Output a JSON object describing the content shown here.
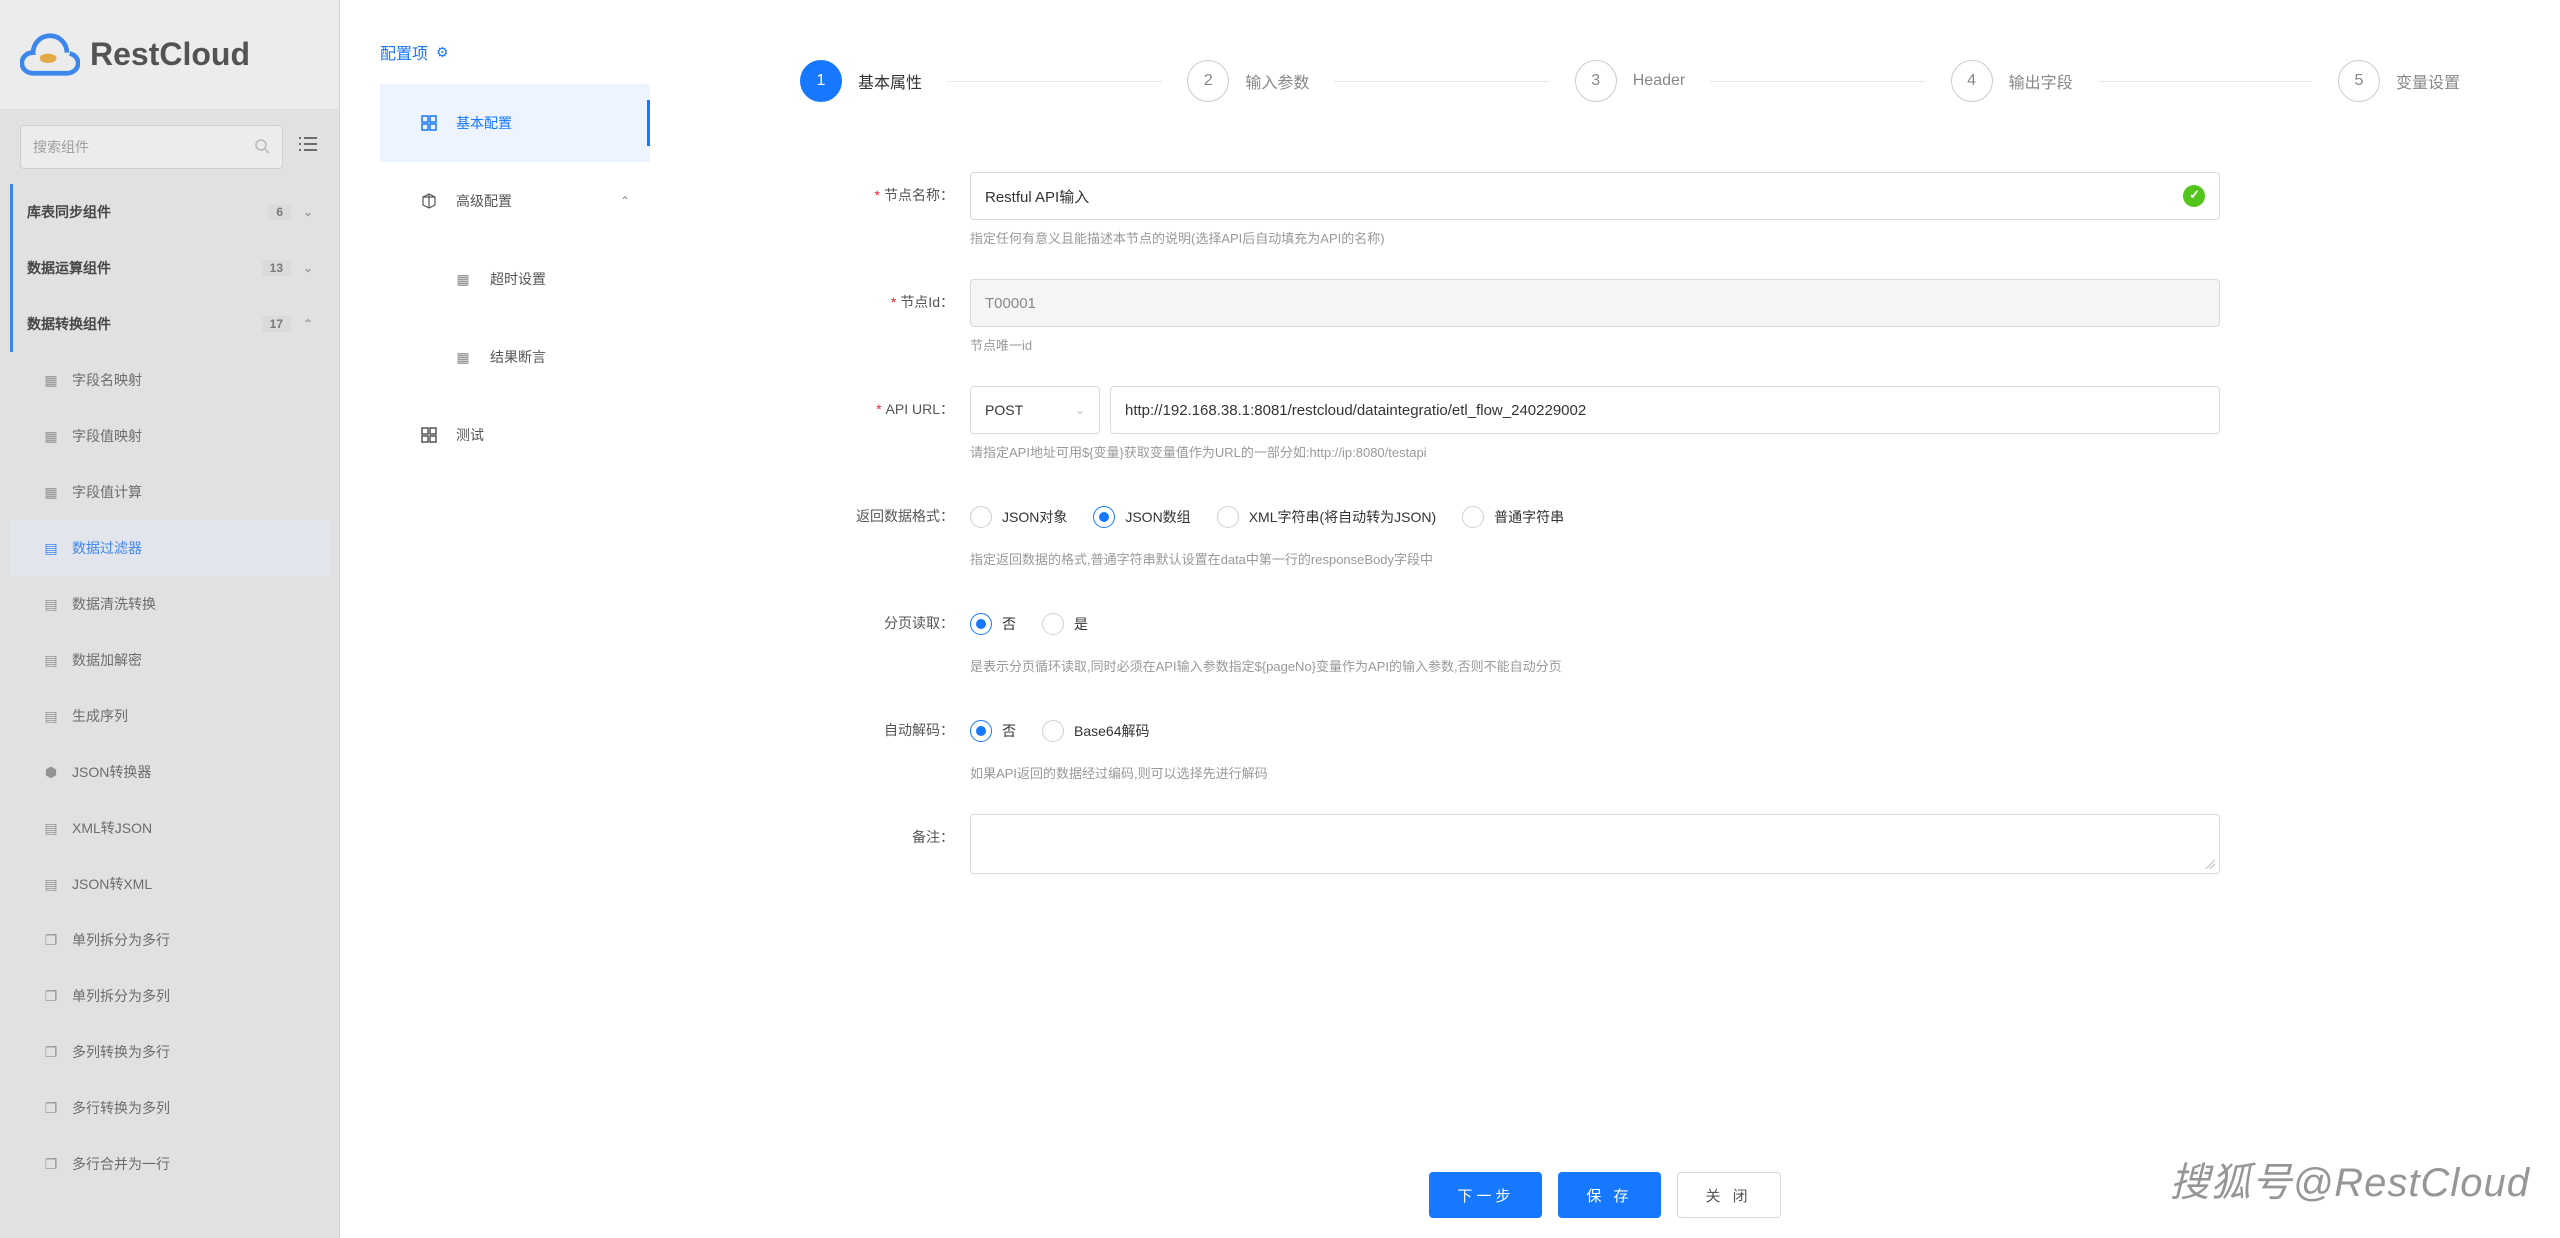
{
  "app": {
    "logo_text": "RestCloud",
    "search_placeholder": "搜索组件"
  },
  "side": {
    "groups": [
      {
        "label": "库表同步组件",
        "badge": "6",
        "expanded": false
      },
      {
        "label": "数据运算组件",
        "badge": "13",
        "expanded": false
      },
      {
        "label": "数据转换组件",
        "badge": "17",
        "expanded": true
      }
    ],
    "subs": [
      {
        "label": "字段名映射"
      },
      {
        "label": "字段值映射"
      },
      {
        "label": "字段值计算"
      },
      {
        "label": "数据过滤器",
        "active": true
      },
      {
        "label": "数据清洗转换"
      },
      {
        "label": "数据加解密"
      },
      {
        "label": "生成序列"
      },
      {
        "label": "JSON转换器"
      },
      {
        "label": "XML转JSON"
      },
      {
        "label": "JSON转XML"
      },
      {
        "label": "单列拆分为多行"
      },
      {
        "label": "单列拆分为多列"
      },
      {
        "label": "多列转换为多行"
      },
      {
        "label": "多行转换为多列"
      },
      {
        "label": "多行合并为一行"
      }
    ]
  },
  "cfg": {
    "title": "配置项",
    "nav": {
      "basic": "基本配置",
      "advanced": "高级配置",
      "timeout": "超时设置",
      "assert": "结果断言",
      "test": "测试"
    }
  },
  "steps": [
    {
      "num": "1",
      "label": "基本属性"
    },
    {
      "num": "2",
      "label": "输入参数"
    },
    {
      "num": "3",
      "label": "Header"
    },
    {
      "num": "4",
      "label": "输出字段"
    },
    {
      "num": "5",
      "label": "变量设置"
    }
  ],
  "form": {
    "node_name": {
      "label": "节点名称：",
      "value": "Restful API输入",
      "hint": "指定任何有意义且能描述本节点的说明(选择API后自动填充为API的名称)"
    },
    "node_id": {
      "label": "节点Id：",
      "value": "T00001",
      "hint": "节点唯一id"
    },
    "api_url": {
      "label": "API URL：",
      "method": "POST",
      "value": "http://192.168.38.1:8081/restcloud/dataintegratio/etl_flow_240229002",
      "hint": "请指定API地址可用${变量}获取变量值作为URL的一部分如:http://ip:8080/testapi"
    },
    "resp_fmt": {
      "label": "返回数据格式：",
      "options": [
        "JSON对象",
        "JSON数组",
        "XML字符串(将自动转为JSON)",
        "普通字符串"
      ],
      "selected": 1,
      "hint": "指定返回数据的格式,普通字符串默认设置在data中第一行的responseBody字段中"
    },
    "page": {
      "label": "分页读取：",
      "options": [
        "否",
        "是"
      ],
      "selected": 0,
      "hint": "是表示分页循环读取,同时必须在API输入参数指定${pageNo}变量作为API的输入参数,否则不能自动分页"
    },
    "decode": {
      "label": "自动解码：",
      "options": [
        "否",
        "Base64解码"
      ],
      "selected": 0,
      "hint": "如果API返回的数据经过编码,则可以选择先进行解码"
    },
    "remark": {
      "label": "备注：",
      "value": ""
    }
  },
  "buttons": {
    "next": "下一步",
    "save": "保 存",
    "close": "关 闭"
  },
  "watermark": "搜狐号@RestCloud"
}
